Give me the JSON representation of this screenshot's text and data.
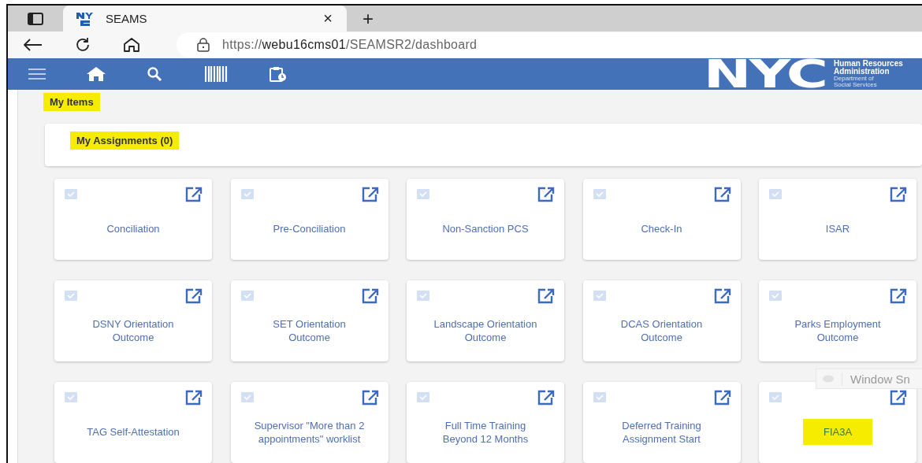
{
  "browser": {
    "tab": {
      "title": "SEAMS",
      "close": "×"
    },
    "new_tab": "+",
    "url": {
      "scheme": "https://",
      "host": "webu16cms01",
      "path": "/SEAMSR2/dashboard"
    }
  },
  "navbar": {
    "logo": {
      "mark": "NYC",
      "agency": "Human Resources Administration",
      "department": "Department of Social Services"
    }
  },
  "section": {
    "title": "My Items",
    "highlighted": true
  },
  "assignments": {
    "label": "My Assignments (0)",
    "highlighted": true
  },
  "tiles": [
    {
      "label": "Conciliation",
      "highlighted": false
    },
    {
      "label": "Pre-Conciliation",
      "highlighted": false
    },
    {
      "label": "Non-Sanction PCS",
      "highlighted": false
    },
    {
      "label": "Check-In",
      "highlighted": false
    },
    {
      "label": "ISAR",
      "highlighted": false
    },
    {
      "label": "DSNY Orientation Outcome",
      "highlighted": false
    },
    {
      "label": "SET Orientation Outcome",
      "highlighted": false
    },
    {
      "label": "Landscape Orientation Outcome",
      "highlighted": false
    },
    {
      "label": "DCAS Orientation Outcome",
      "highlighted": false
    },
    {
      "label": "Parks Employment Outcome",
      "highlighted": false
    },
    {
      "label": "TAG Self-Attestation",
      "highlighted": false
    },
    {
      "label": "Supervisor \"More than 2 appointments\" worklist",
      "highlighted": false
    },
    {
      "label": "Full Time Training Beyond 12 Months",
      "highlighted": false
    },
    {
      "label": "Deferred Training Assignment Start",
      "highlighted": false
    },
    {
      "label": "FIA3A",
      "highlighted": true
    }
  ],
  "overlay": {
    "label": "Window Sn"
  }
}
